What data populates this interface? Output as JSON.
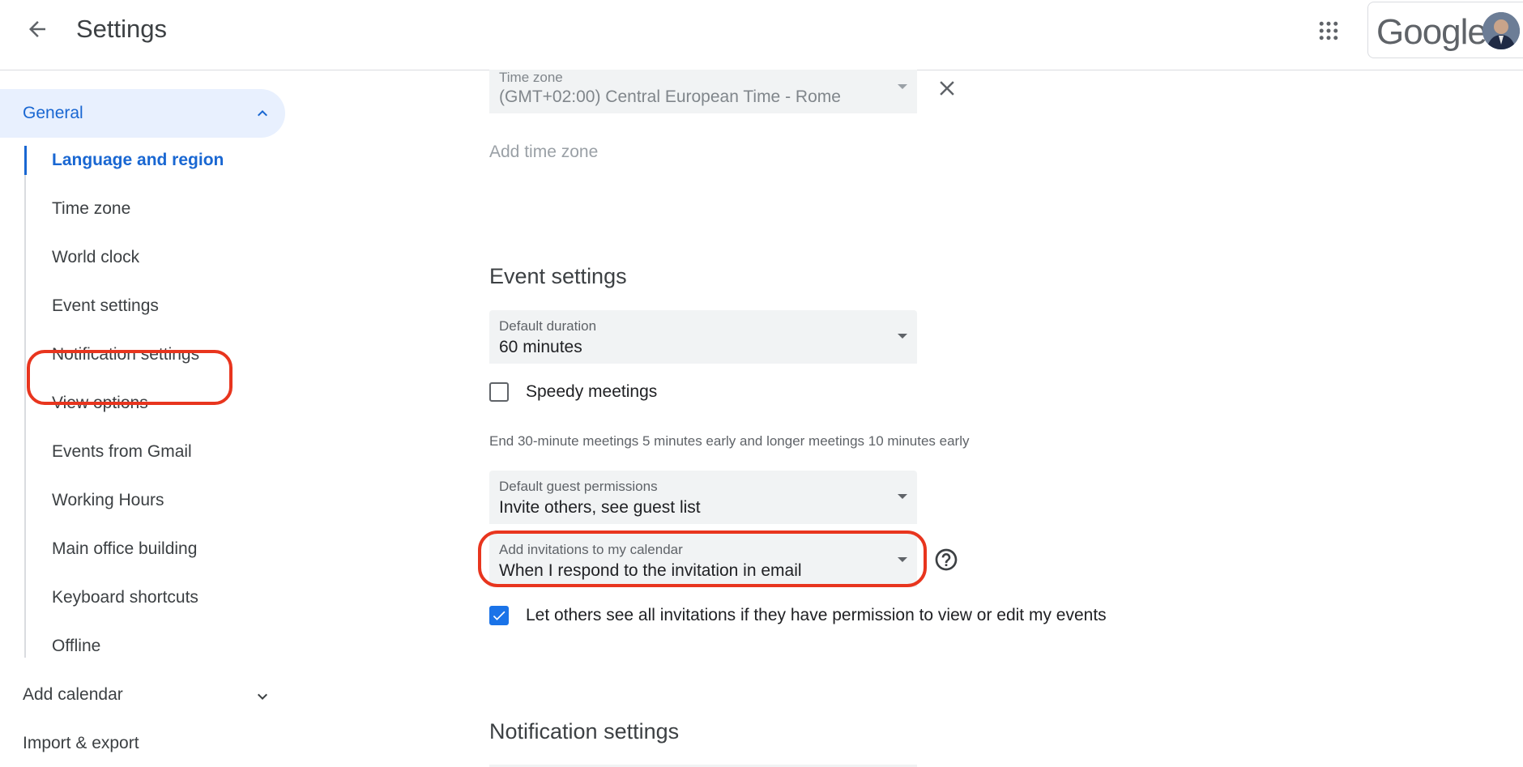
{
  "header": {
    "title": "Settings",
    "logo_text": "Google"
  },
  "sidebar": {
    "general_label": "General",
    "items": [
      {
        "label": "Language and region"
      },
      {
        "label": "Time zone"
      },
      {
        "label": "World clock"
      },
      {
        "label": "Event settings"
      },
      {
        "label": "Notification settings"
      },
      {
        "label": "View options"
      },
      {
        "label": "Events from Gmail"
      },
      {
        "label": "Working Hours"
      },
      {
        "label": "Main office building"
      },
      {
        "label": "Keyboard shortcuts"
      },
      {
        "label": "Offline"
      }
    ],
    "add_calendar": "Add calendar",
    "import_export": "Import & export"
  },
  "main": {
    "time_zone_field": {
      "label": "Time zone",
      "value": "(GMT+02:00) Central European Time - Rome"
    },
    "add_time_zone": "Add time zone",
    "event_settings_title": "Event settings",
    "default_duration": {
      "label": "Default duration",
      "value": "60 minutes"
    },
    "speedy_meetings_label": "Speedy meetings",
    "speedy_helper": "End 30-minute meetings 5 minutes early and longer meetings 10 minutes early",
    "guest_permissions": {
      "label": "Default guest permissions",
      "value": "Invite others, see guest list"
    },
    "add_invitations": {
      "label": "Add invitations to my calendar",
      "value": "When I respond to the invitation in email"
    },
    "let_others_label": "Let others see all invitations if they have permission to view or edit my events",
    "notification_settings_title": "Notification settings"
  },
  "colors": {
    "accent": "#1967d2",
    "annotation": "#e8351e",
    "checkbox_checked": "#1a73e8"
  }
}
